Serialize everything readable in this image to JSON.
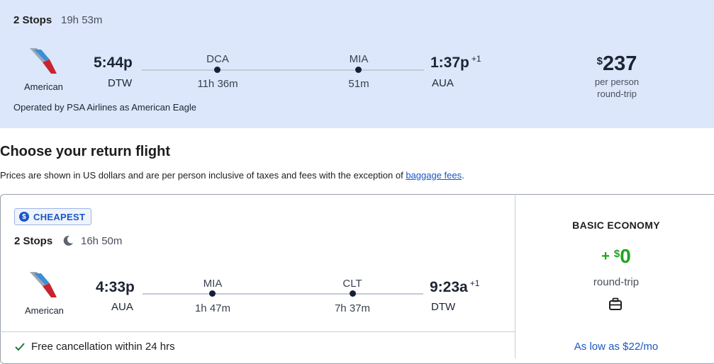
{
  "outbound": {
    "stops": "2 Stops",
    "duration": "19h 53m",
    "airline": "American",
    "depart_time": "5:44p",
    "depart_code": "DTW",
    "stop1_code": "DCA",
    "stop1_layover": "11h 36m",
    "stop2_code": "MIA",
    "stop2_layover": "51m",
    "arrive_time": "1:37p",
    "arrive_plus": "+1",
    "arrive_code": "AUA",
    "price_currency": "$",
    "price_amount": "237",
    "price_per": "per person",
    "price_trip": "round-trip",
    "operated_by": "Operated by PSA Airlines as American Eagle"
  },
  "heading": "Choose your return flight",
  "disclaimer": {
    "text": "Prices are shown in US dollars and are per person inclusive of taxes and fees with the exception of ",
    "link": "baggage fees",
    "end": "."
  },
  "return": {
    "badge": "CHEAPEST",
    "badge_icon": "dollar-badge-icon",
    "stops": "2 Stops",
    "duration": "16h 50m",
    "airline": "American",
    "depart_time": "4:33p",
    "depart_code": "AUA",
    "stop1_code": "MIA",
    "stop1_layover": "1h 47m",
    "stop2_code": "CLT",
    "stop2_layover": "7h 37m",
    "arrive_time": "9:23a",
    "arrive_plus": "+1",
    "arrive_code": "DTW",
    "free_cancel": "Free cancellation within 24 hrs",
    "fare_class": "BASIC ECONOMY",
    "fare_plus": "+",
    "fare_currency": "$",
    "fare_amount": "0",
    "fare_trip": "round-trip",
    "low_as": "As low as $22/mo"
  },
  "colors": {
    "panel_bg": "#dce7fb",
    "accent_blue": "#1a56c4",
    "price_green": "#20a320",
    "aa_red": "#c8242e",
    "aa_blue": "#3b8fd6"
  }
}
